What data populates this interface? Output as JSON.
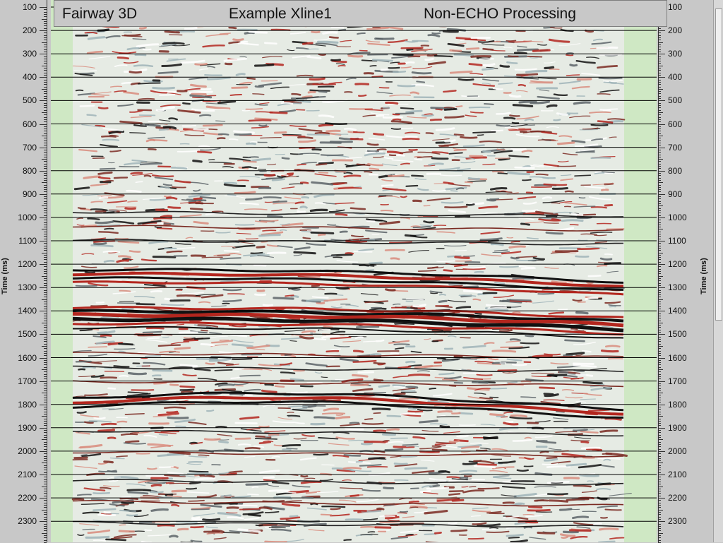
{
  "title_bar": {
    "survey": "Fairway 3D",
    "line": "Example Xline1",
    "processing": "Non-ECHO Processing"
  },
  "axis": {
    "label": "Time (ms)",
    "ticks": [
      "100",
      "200",
      "300",
      "400",
      "500",
      "600",
      "700",
      "800",
      "900",
      "1000",
      "1100",
      "1200",
      "1300",
      "1400",
      "1500",
      "1600",
      "1700",
      "1800",
      "1900",
      "2000",
      "2100",
      "2200",
      "2300"
    ]
  },
  "colors": {
    "background": "#cfe8c4",
    "positive": "#b3261e",
    "negative": "#111111",
    "light": "#eef5ef",
    "panel": "#c8c8c8"
  }
}
